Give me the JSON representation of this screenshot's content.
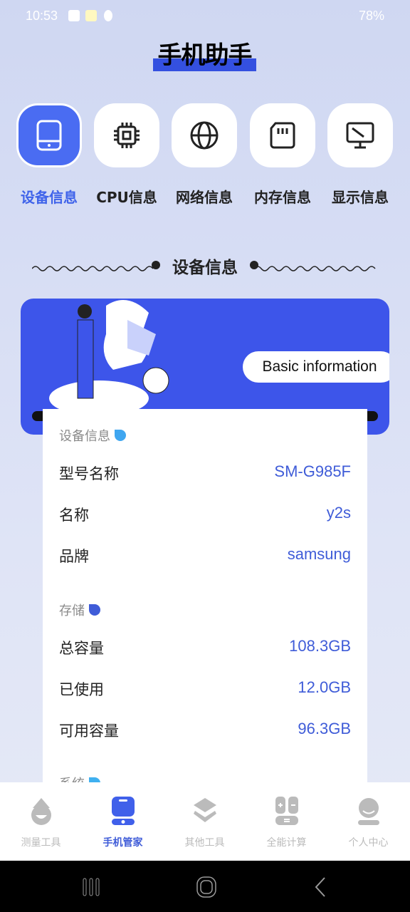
{
  "status_bar": {
    "time": "10:53",
    "battery": "78%"
  },
  "app_title": "手机助手",
  "categories": [
    {
      "label": "设备信息",
      "icon": "tablet-icon",
      "active": true
    },
    {
      "label": "CPU信息",
      "icon": "cpu-icon",
      "active": false
    },
    {
      "label": "网络信息",
      "icon": "globe-icon",
      "active": false
    },
    {
      "label": "内存信息",
      "icon": "sd-card-icon",
      "active": false
    },
    {
      "label": "显示信息",
      "icon": "monitor-icon",
      "active": false
    }
  ],
  "section_title": "设备信息",
  "banner": {
    "button": "Basic information"
  },
  "groups": {
    "device": {
      "title": "设备信息",
      "rows": [
        {
          "k": "型号名称",
          "v": "SM-G985F"
        },
        {
          "k": "名称",
          "v": "y2s"
        },
        {
          "k": "品牌",
          "v": "samsung"
        }
      ]
    },
    "storage": {
      "title": "存储",
      "rows": [
        {
          "k": "总容量",
          "v": "108.3GB"
        },
        {
          "k": "已使用",
          "v": "12.0GB"
        },
        {
          "k": "可用容量",
          "v": "96.3GB"
        }
      ]
    },
    "system": {
      "title": "系统"
    }
  },
  "tabs": [
    {
      "label": "测量工具",
      "active": false
    },
    {
      "label": "手机管家",
      "active": true
    },
    {
      "label": "其他工具",
      "active": false
    },
    {
      "label": "全能计算",
      "active": false
    },
    {
      "label": "个人中心",
      "active": false
    }
  ],
  "colors": {
    "accent": "#3f5cd8",
    "banner": "#3d55ea"
  }
}
